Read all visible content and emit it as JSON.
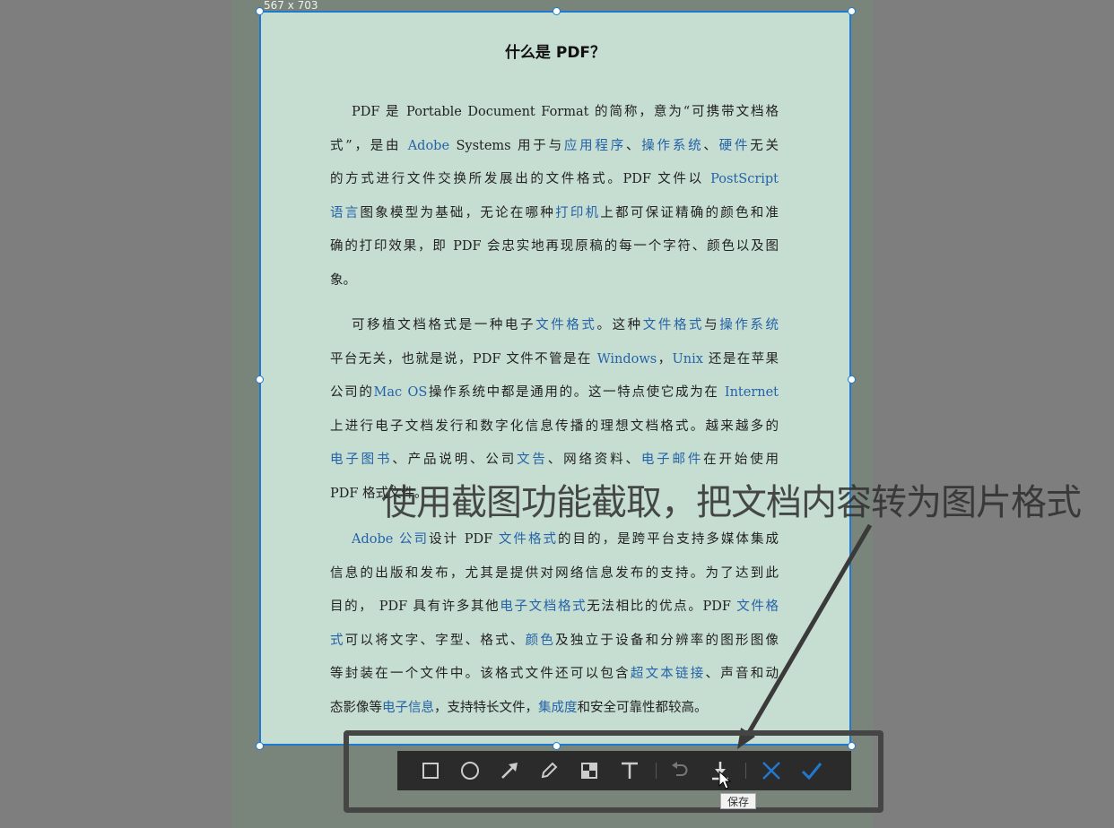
{
  "selection": {
    "size_label": "567 x 703"
  },
  "document": {
    "title": "什么是 PDF？",
    "paragraphs": [
      [
        [
          [
            "PDF 是 Portable Document Format 的简称，意为“可携带文档格",
            0
          ]
        ],
        [
          [
            "式”，是由 ",
            0
          ],
          [
            "Adobe",
            1
          ],
          [
            "  Systems 用于与",
            0
          ],
          [
            "应用程序",
            1
          ],
          [
            "、",
            0
          ],
          [
            "操作系统",
            1
          ],
          [
            "、",
            0
          ],
          [
            "硬件",
            1
          ],
          [
            "无关",
            0
          ]
        ],
        [
          [
            "的方式进行文件交换所发展出的文件格式。PDF 文件以 ",
            0
          ],
          [
            "PostScript",
            1
          ]
        ],
        [
          [
            "语言",
            1
          ],
          [
            "图象模型为基础，无论在哪种",
            0
          ],
          [
            "打印机",
            1
          ],
          [
            "上都可保证精确的颜色和准",
            0
          ]
        ],
        [
          [
            "确的打印效果，即 PDF 会忠实地再现原稿的每一个字符、颜色以及图",
            0
          ]
        ],
        [
          [
            "象。",
            0
          ]
        ]
      ],
      [
        [
          [
            "可移植文档格式是一种电子",
            0
          ],
          [
            "文件格式",
            1
          ],
          [
            "。这种",
            0
          ],
          [
            "文件格式",
            1
          ],
          [
            "与",
            0
          ],
          [
            "操作系统",
            1
          ]
        ],
        [
          [
            "平台无关，也就是说，PDF 文件不管是在 ",
            0
          ],
          [
            "Windows",
            1
          ],
          [
            "，",
            0
          ],
          [
            "Unix",
            1
          ],
          [
            " 还是在苹果",
            0
          ]
        ],
        [
          [
            "公司的",
            0
          ],
          [
            "Mac OS",
            1
          ],
          [
            "操作系统中都是通用的。这一特点使它成为在 ",
            0
          ],
          [
            "Internet",
            1
          ]
        ],
        [
          [
            "上进行电子文档发行和数字化信息传播的理想文档格式。越来越多的",
            0
          ]
        ],
        [
          [
            "电子图书",
            1
          ],
          [
            "、产品说明、公司",
            0
          ],
          [
            "文告",
            1
          ],
          [
            "、网络资料、",
            0
          ],
          [
            "电子邮件",
            1
          ],
          [
            "在开始使用",
            0
          ]
        ],
        [
          [
            "PDF 格式文件。",
            0
          ]
        ]
      ],
      [
        [
          [
            "Adobe 公司",
            1
          ],
          [
            "设计 PDF ",
            0
          ],
          [
            "文件格式",
            1
          ],
          [
            "的目的，是跨平台支持多媒体集成",
            0
          ]
        ],
        [
          [
            "信息的出版和发布，尤其是提供对网络信息发布的支持。为了达到此",
            0
          ]
        ],
        [
          [
            "目的， PDF 具有许多其他",
            0
          ],
          [
            "电子文档格式",
            1
          ],
          [
            "无法相比的优点。PDF ",
            0
          ],
          [
            "文件格",
            1
          ]
        ],
        [
          [
            "式",
            1
          ],
          [
            "可以将文字、字型、格式、",
            0
          ],
          [
            "颜色",
            1
          ],
          [
            "及独立于设备和分辨率的图形图像",
            0
          ]
        ],
        [
          [
            "等封装在一个文件中。该格式文件还可以包含",
            0
          ],
          [
            "超文本链接",
            1
          ],
          [
            "、声音和动",
            0
          ]
        ],
        [
          [
            "态影像等",
            0
          ],
          [
            "电子信息",
            1
          ],
          [
            "，支持特长文件，",
            0
          ],
          [
            "集成度",
            1
          ],
          [
            "和安全可靠性都较高。",
            0
          ]
        ]
      ]
    ]
  },
  "caption": "使用截图功能截取，把文档内容转为图片格式",
  "toolbar": {
    "tools": [
      "rectangle",
      "ellipse",
      "arrow",
      "pencil",
      "mosaic",
      "text",
      "undo",
      "save",
      "cancel",
      "confirm"
    ],
    "tooltip": "保存"
  },
  "colors": {
    "link": "#2563a8",
    "accent": "#1e7ad0"
  }
}
